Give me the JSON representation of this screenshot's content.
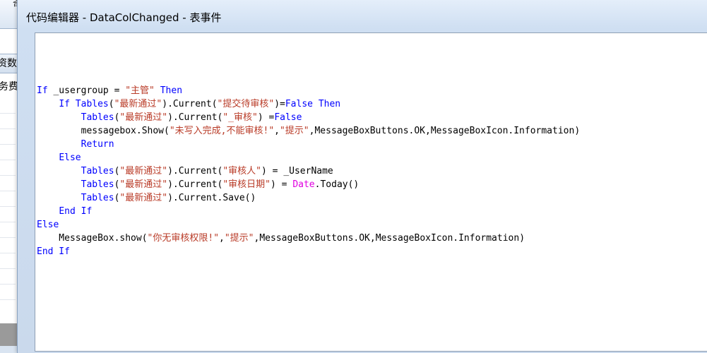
{
  "window": {
    "title": "代码编辑器 - DataColChanged - 表事件"
  },
  "background": {
    "toolbar_glyph": "奇",
    "tab_text": "资数据",
    "label_text": "务费"
  },
  "code": {
    "lines": [
      [
        {
          "t": "If",
          "c": "kw"
        },
        {
          "t": " _usergroup = ",
          "c": ""
        },
        {
          "t": "\"主管\"",
          "c": "str"
        },
        {
          "t": " ",
          "c": ""
        },
        {
          "t": "Then",
          "c": "kw"
        }
      ],
      [
        {
          "t": "    ",
          "c": ""
        },
        {
          "t": "If",
          "c": "kw"
        },
        {
          "t": " ",
          "c": ""
        },
        {
          "t": "Tables",
          "c": "kw"
        },
        {
          "t": "(",
          "c": ""
        },
        {
          "t": "\"最新通过\"",
          "c": "str"
        },
        {
          "t": ").Current(",
          "c": ""
        },
        {
          "t": "\"提交待审核\"",
          "c": "str"
        },
        {
          "t": ")=",
          "c": ""
        },
        {
          "t": "False",
          "c": "kw"
        },
        {
          "t": " ",
          "c": ""
        },
        {
          "t": "Then",
          "c": "kw"
        }
      ],
      [
        {
          "t": "        ",
          "c": ""
        },
        {
          "t": "Tables",
          "c": "kw"
        },
        {
          "t": "(",
          "c": ""
        },
        {
          "t": "\"最新通过\"",
          "c": "str"
        },
        {
          "t": ").Current(",
          "c": ""
        },
        {
          "t": "\"_审核\"",
          "c": "str"
        },
        {
          "t": ") =",
          "c": ""
        },
        {
          "t": "False",
          "c": "kw"
        }
      ],
      [
        {
          "t": "        messagebox.Show(",
          "c": ""
        },
        {
          "t": "\"未写入完成,不能审核!\"",
          "c": "str"
        },
        {
          "t": ",",
          "c": ""
        },
        {
          "t": "\"提示\"",
          "c": "str"
        },
        {
          "t": ",MessageBoxButtons.OK,MessageBoxIcon.Information)",
          "c": ""
        }
      ],
      [
        {
          "t": "        ",
          "c": ""
        },
        {
          "t": "Return",
          "c": "kw"
        }
      ],
      [
        {
          "t": "    ",
          "c": ""
        },
        {
          "t": "Else",
          "c": "kw"
        }
      ],
      [
        {
          "t": "        ",
          "c": ""
        },
        {
          "t": "Tables",
          "c": "kw"
        },
        {
          "t": "(",
          "c": ""
        },
        {
          "t": "\"最新通过\"",
          "c": "str"
        },
        {
          "t": ").Current(",
          "c": ""
        },
        {
          "t": "\"审核人\"",
          "c": "str"
        },
        {
          "t": ") = _UserName",
          "c": ""
        }
      ],
      [
        {
          "t": "        ",
          "c": ""
        },
        {
          "t": "Tables",
          "c": "kw"
        },
        {
          "t": "(",
          "c": ""
        },
        {
          "t": "\"最新通过\"",
          "c": "str"
        },
        {
          "t": ").Current(",
          "c": ""
        },
        {
          "t": "\"审核日期\"",
          "c": "str"
        },
        {
          "t": ") = ",
          "c": ""
        },
        {
          "t": "Date",
          "c": "fn"
        },
        {
          "t": ".Today()",
          "c": ""
        }
      ],
      [
        {
          "t": "        ",
          "c": ""
        },
        {
          "t": "Tables",
          "c": "kw"
        },
        {
          "t": "(",
          "c": ""
        },
        {
          "t": "\"最新通过\"",
          "c": "str"
        },
        {
          "t": ").Current.Save()",
          "c": ""
        }
      ],
      [
        {
          "t": "    ",
          "c": ""
        },
        {
          "t": "End If",
          "c": "kw"
        }
      ],
      [
        {
          "t": "Else",
          "c": "kw"
        }
      ],
      [
        {
          "t": "    MessageBox.show(",
          "c": ""
        },
        {
          "t": "\"你无审核权限!\"",
          "c": "str"
        },
        {
          "t": ",",
          "c": ""
        },
        {
          "t": "\"提示\"",
          "c": "str"
        },
        {
          "t": ",MessageBoxButtons.OK,MessageBoxIcon.Information)",
          "c": ""
        }
      ],
      [
        {
          "t": "End If",
          "c": "kw"
        }
      ]
    ]
  },
  "colors": {
    "keyword": "#0000ff",
    "string": "#b93b27",
    "function": "#e000e0"
  }
}
